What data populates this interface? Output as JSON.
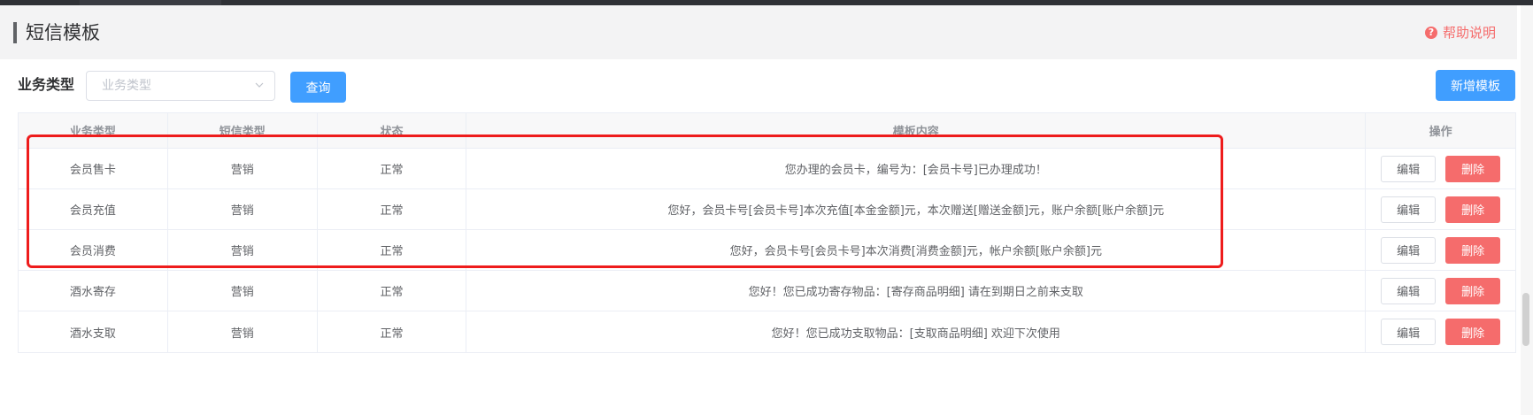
{
  "header": {
    "title": "短信模板",
    "help_label": "帮助说明",
    "help_icon": "question-circle-icon"
  },
  "filter": {
    "label": "业务类型",
    "select_placeholder": "业务类型",
    "query_label": "查询",
    "add_label": "新增模板"
  },
  "table": {
    "columns": [
      "业务类型",
      "短信类型",
      "状态",
      "模板内容",
      "操作"
    ],
    "rows": [
      {
        "business": "会员售卡",
        "sms_type": "营销",
        "status": "正常",
        "content": "您办理的会员卡，编号为：[会员卡号]已办理成功！",
        "edit": "编辑",
        "delete": "删除"
      },
      {
        "business": "会员充值",
        "sms_type": "营销",
        "status": "正常",
        "content": "您好，会员卡号[会员卡号]本次充值[本金金额]元，本次赠送[赠送金额]元，账户余额[账户余额]元",
        "edit": "编辑",
        "delete": "删除"
      },
      {
        "business": "会员消费",
        "sms_type": "营销",
        "status": "正常",
        "content": "您好，会员卡号[会员卡号]本次消费[消费金额]元，帐户余额[账户余额]元",
        "edit": "编辑",
        "delete": "删除"
      },
      {
        "business": "酒水寄存",
        "sms_type": "营销",
        "status": "正常",
        "content": "您好！您已成功寄存物品：[寄存商品明细] 请在到期日之前来支取",
        "edit": "编辑",
        "delete": "删除"
      },
      {
        "business": "酒水支取",
        "sms_type": "营销",
        "status": "正常",
        "content": "您好！您已成功支取物品：[支取商品明细] 欢迎下次使用",
        "edit": "编辑",
        "delete": "删除"
      }
    ]
  },
  "colors": {
    "primary": "#409eff",
    "danger": "#f56c6c",
    "highlight": "#ee1c1c"
  }
}
